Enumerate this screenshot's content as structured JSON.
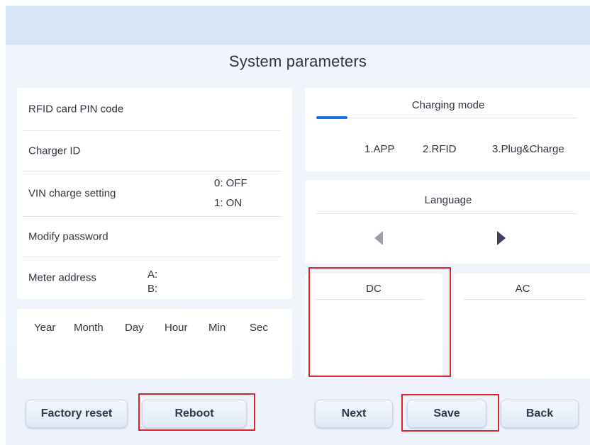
{
  "page": {
    "title": "System parameters"
  },
  "settings": {
    "rfid_label": "RFID card PIN code",
    "charger_id_label": "Charger ID",
    "vin_label": "VIN charge setting",
    "vin_off": "0: OFF",
    "vin_on": "1: ON",
    "password_label": "Modify password",
    "meter_label": "Meter address",
    "meter_a": "A:",
    "meter_b": "B:"
  },
  "datetime": {
    "fields": [
      "Year",
      "Month",
      "Day",
      "Hour",
      "Min",
      "Sec"
    ]
  },
  "charging_mode": {
    "title": "Charging mode",
    "options": [
      "1.APP",
      "2.RFID",
      "3.Plug&Charge"
    ]
  },
  "language": {
    "title": "Language"
  },
  "power": {
    "dc": "DC",
    "ac": "AC"
  },
  "buttons": {
    "factory_reset": "Factory reset",
    "reboot": "Reboot",
    "next": "Next",
    "save": "Save",
    "back": "Back"
  },
  "colors": {
    "accent": "#1e6fe0",
    "highlight": "#d9262b",
    "arrow": "#3a4658",
    "arrow_disabled": "#9aa3ae"
  }
}
